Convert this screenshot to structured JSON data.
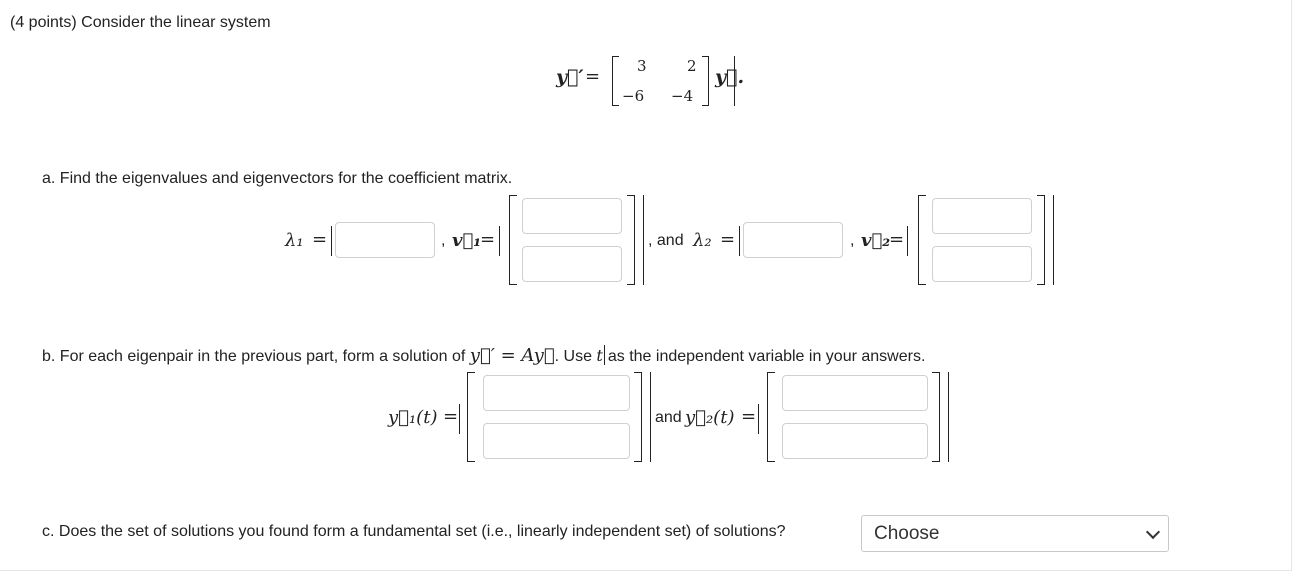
{
  "problem": {
    "intro": "(4 points) Consider the linear system",
    "system": {
      "lhs": "y⃗′",
      "equals": "=",
      "matrix": [
        [
          "3",
          "2"
        ],
        [
          "−6",
          "−4"
        ]
      ],
      "rhs": "y⃗."
    }
  },
  "part_a": {
    "prompt": "a. Find the eigenvalues and eigenvectors for the coefficient matrix.",
    "lambda1": "λ₁",
    "v1": "v⃗₁",
    "sep_comma": ",",
    "and_text": ", and",
    "lambda2": "λ₂",
    "v2": "v⃗₂",
    "equals": "="
  },
  "part_b": {
    "prompt_prefix": "b. For each eigenpair in the previous part, form a solution of",
    "prompt_eq": "y⃗′ = Ay⃗",
    "prompt_mid": ". Use",
    "prompt_var": "t",
    "prompt_suffix": "as the independent variable in your answers.",
    "y1": "y⃗₁(t)",
    "and_text": "and",
    "y2": "y⃗₂(t)",
    "equals": "="
  },
  "part_c": {
    "prompt": "c. Does the set of solutions you found form a fundamental set (i.e., linearly independent set) of solutions?",
    "select_value": "Choose"
  }
}
